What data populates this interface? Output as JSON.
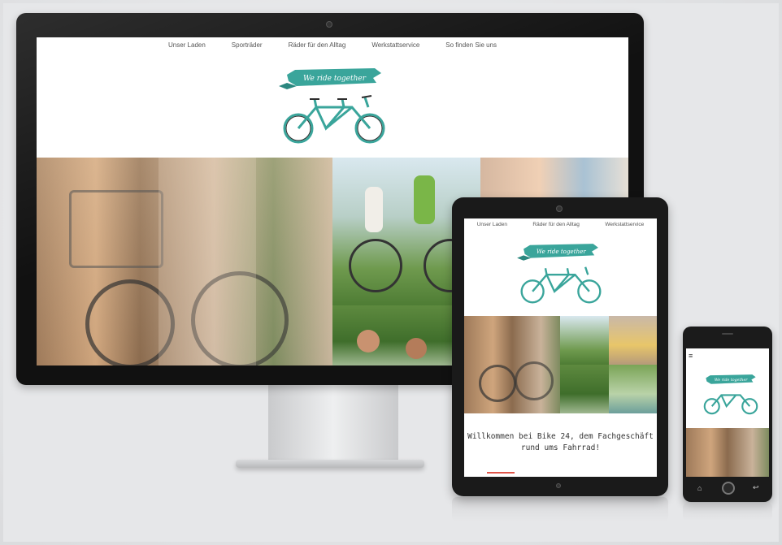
{
  "desktop": {
    "nav": [
      "Unser Laden",
      "Sporträder",
      "Räder für den Alltag",
      "Werkstattservice",
      "So finden Sie uns"
    ],
    "logo_text": "We ride together"
  },
  "tablet": {
    "nav": [
      "Unser Laden",
      "Räder für den Alltag",
      "Werkstattservice"
    ],
    "logo_text": "We ride together",
    "welcome_line1": "Willkommen bei Bike 24, dem Fachgeschäft",
    "welcome_line2": "rund ums Fahrrad!"
  },
  "phone": {
    "logo_text": "We ride together",
    "menu_icon": "hamburger-icon",
    "buttons": [
      "home-icon",
      "home-button",
      "back-icon"
    ]
  },
  "colors": {
    "brand_teal": "#3aa59b",
    "accent_red": "#e0564a",
    "nav_text": "#555555"
  }
}
